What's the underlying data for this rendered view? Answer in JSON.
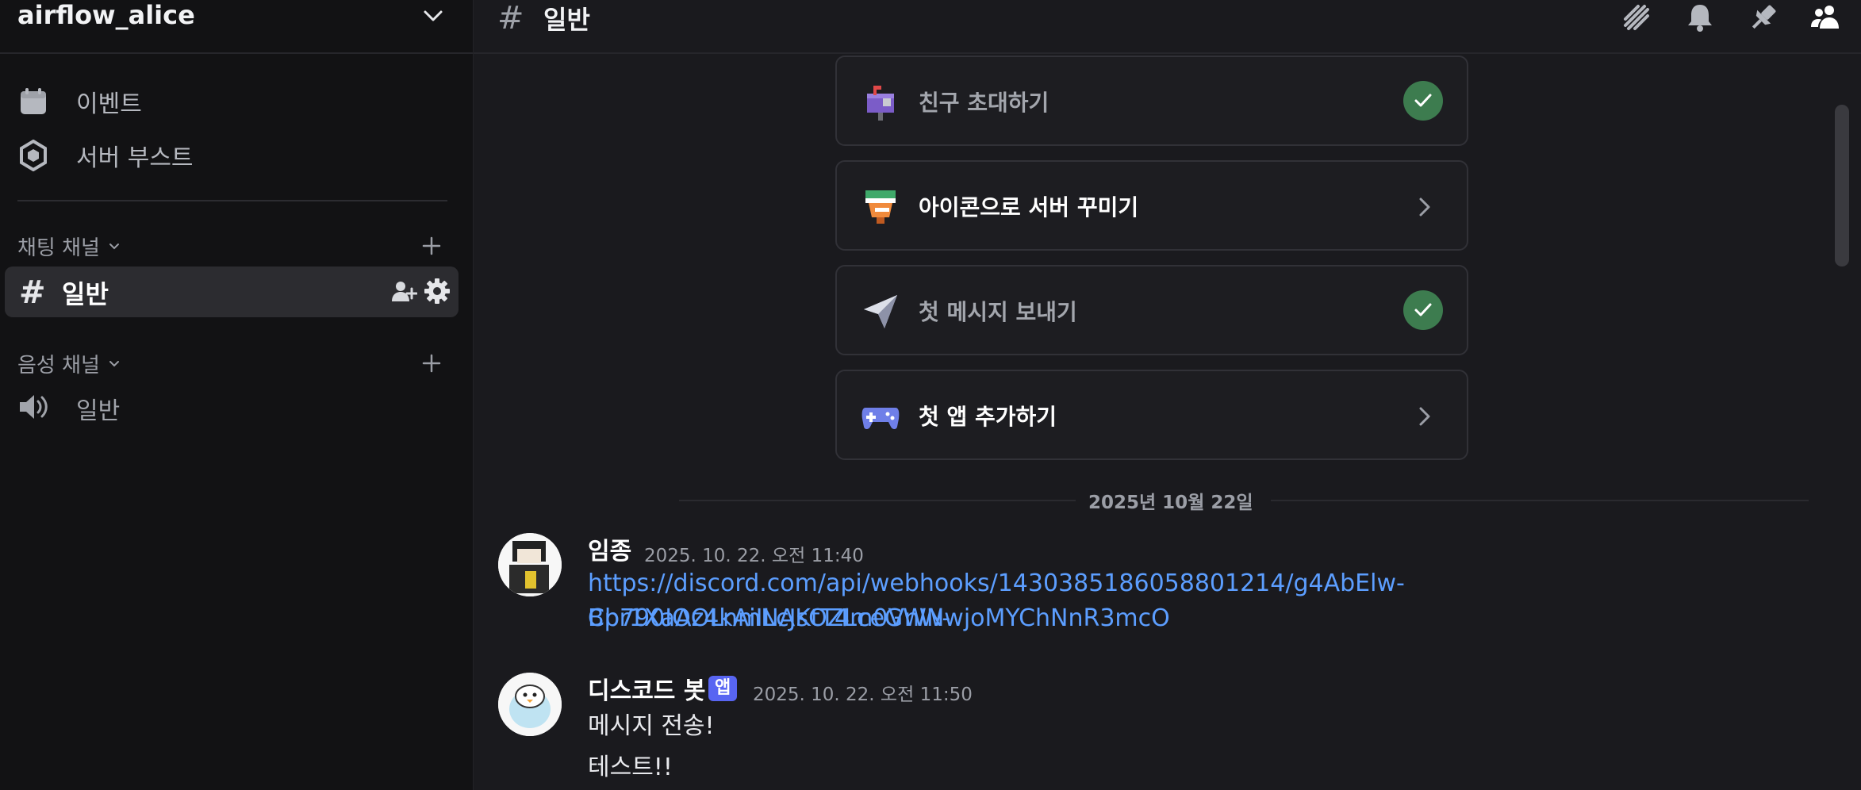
{
  "sidebar": {
    "server_name": "airflow_alice",
    "items": [
      {
        "label": "이벤트",
        "icon": "calendar-icon"
      },
      {
        "label": "서버 부스트",
        "icon": "boost-icon"
      }
    ],
    "text_category": "채팅 채널",
    "active_channel": "일반",
    "voice_category": "음성 채널",
    "voice_channel": "일반"
  },
  "topbar": {
    "hash": "#",
    "title": "일반",
    "icons": [
      "threads-icon",
      "bell-icon",
      "pin-icon",
      "members-icon"
    ]
  },
  "checklist": [
    {
      "label": "친구 초대하기",
      "status": "done",
      "icon": "mailbox-icon"
    },
    {
      "label": "아이콘으로 서버 꾸미기",
      "status": "todo",
      "icon": "paint-bucket-icon"
    },
    {
      "label": "첫 메시지 보내기",
      "status": "done",
      "icon": "paper-plane-icon"
    },
    {
      "label": "첫 앱 추가하기",
      "status": "todo",
      "icon": "gamepad-icon"
    }
  ],
  "date_divider": "2025년 10월 22일",
  "messages": [
    {
      "author": "임종",
      "time": "2025. 10. 22. 오전 11:40",
      "lines": [
        "https://discord.com/api/webhooks/1430385186058801214/g4AbElw-Cb790IOOLnmNAKtT4m0VnW-",
        "Bpr1XaAz4kAiILcJsOZLceGWNwjoMYChNnR3mcO"
      ]
    },
    {
      "author": "디스코드 봇",
      "badge": "앱",
      "time": "2025. 10. 22. 오전 11:50",
      "lines": [
        "메시지 전송!",
        "테스트!!"
      ]
    }
  ],
  "colors": {
    "accent_link": "#5c9eff",
    "badge": "#5865f2",
    "check": "#3d7c4f"
  }
}
